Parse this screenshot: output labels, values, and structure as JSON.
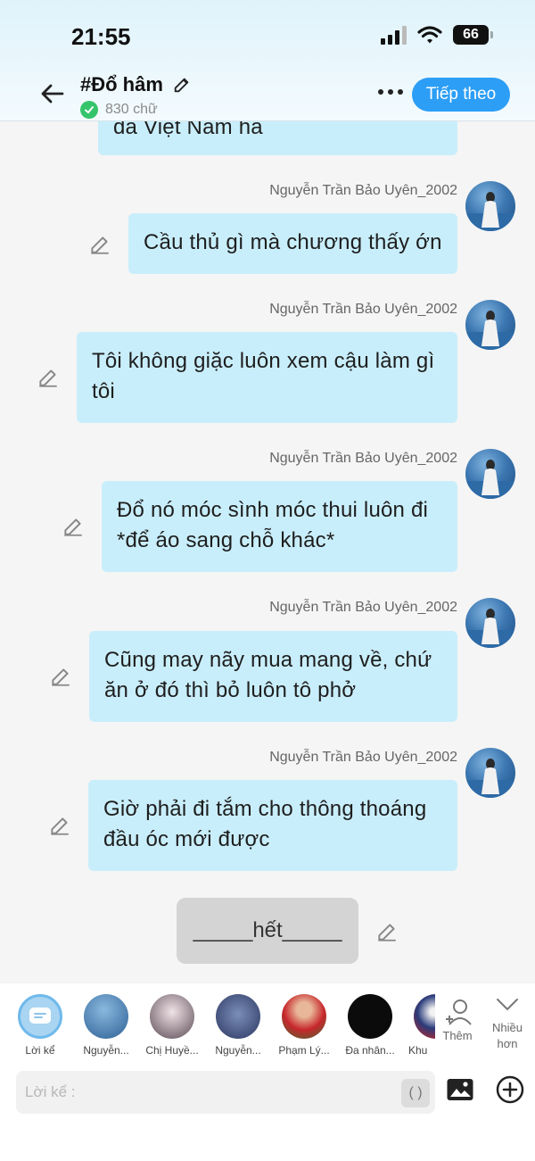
{
  "status": {
    "time": "21:55",
    "battery": "66"
  },
  "header": {
    "title": "#Đổ hâm",
    "word_count": "830 chữ",
    "next_label": "Tiếp theo"
  },
  "messages": [
    {
      "sender": "",
      "text": "đá Việt Nam hả"
    },
    {
      "sender": "Nguyễn Trần Bảo Uyên_2002",
      "text": "Cầu thủ gì mà chương thấy ớn"
    },
    {
      "sender": "Nguyễn Trần Bảo Uyên_2002",
      "text": "Tôi không giặc luôn xem cậu làm gì tôi"
    },
    {
      "sender": "Nguyễn Trần Bảo Uyên_2002",
      "text": "Đổ nó móc sình móc thui luôn đi *để áo sang chỗ khác*"
    },
    {
      "sender": "Nguyễn Trần Bảo Uyên_2002",
      "text": "Cũng may nãy mua mang về, chứ ăn ở đó thì bỏ luôn tô phở"
    },
    {
      "sender": "Nguyễn Trần Bảo Uyên_2002",
      "text": "Giờ phải đi tắm cho thông thoáng đầu óc mới được"
    }
  ],
  "end_text": "_____hết_____",
  "characters": [
    {
      "label": "Lời kể"
    },
    {
      "label": "Nguyễn..."
    },
    {
      "label": "Chị Huyề..."
    },
    {
      "label": "Nguyễn..."
    },
    {
      "label": "Phạm Lý..."
    },
    {
      "label": "Đa nhân..."
    },
    {
      "label": "Khu"
    }
  ],
  "more_characters_label": "Thêm",
  "expand_label_1": "Nhiều",
  "expand_label_2": "hơn",
  "input": {
    "placeholder": "Lời kể :",
    "paren": "( )"
  },
  "colors": {
    "accent": "#2c9ef6",
    "bubble": "#c9eefb",
    "check": "#36c46b"
  }
}
